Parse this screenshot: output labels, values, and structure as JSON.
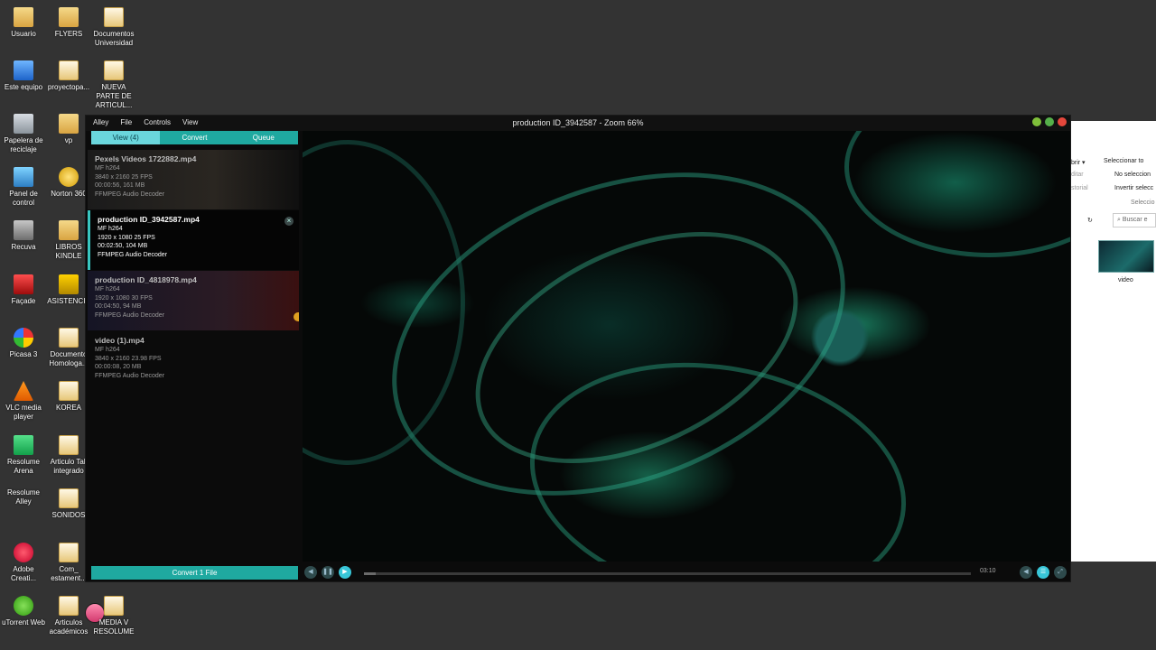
{
  "desktop": {
    "icons": [
      {
        "label": "Usuario",
        "icon": "folder-icon"
      },
      {
        "label": "FLYERS",
        "icon": "folder-icon"
      },
      {
        "label": "Documentos Universidad",
        "icon": "folder-icon"
      },
      {
        "label": "Este equipo",
        "icon": "pc-icon"
      },
      {
        "label": "proyectopa...",
        "icon": "folder-icon"
      },
      {
        "label": "NUEVA PARTE DE ARTICUL...",
        "icon": "document-icon"
      },
      {
        "label": "Papelera de reciclaje",
        "icon": "recycle-bin-icon"
      },
      {
        "label": "vp",
        "icon": "folder-icon"
      },
      {
        "label": "Panel de control",
        "icon": "control-panel-icon"
      },
      {
        "label": "Norton 360",
        "icon": "norton-icon"
      },
      {
        "label": "Recuva",
        "icon": "recuva-icon"
      },
      {
        "label": "LIBROS KINDLE",
        "icon": "folder-icon"
      },
      {
        "label": "Façade",
        "icon": "facade-icon"
      },
      {
        "label": "ASISTENCIA",
        "icon": "folder-icon"
      },
      {
        "label": "Picasa 3",
        "icon": "picasa-icon"
      },
      {
        "label": "Documento Homologa...",
        "icon": "document-icon"
      },
      {
        "label": "VLC media player",
        "icon": "vlc-icon"
      },
      {
        "label": "KOREA",
        "icon": "folder-icon"
      },
      {
        "label": "Resolume Arena",
        "icon": "resolume-icon"
      },
      {
        "label": "Articulo Tall integrado",
        "icon": "document-icon"
      },
      {
        "label": "Resolume Alley",
        "icon": "alley-icon"
      },
      {
        "label": "SONIDOS",
        "icon": "folder-icon"
      },
      {
        "label": "Adobe Creati...",
        "icon": "adobe-icon"
      },
      {
        "label": "Com_ estament...",
        "icon": "document-icon"
      },
      {
        "label": "uTorrent Web",
        "icon": "utorrent-icon"
      },
      {
        "label": "Articulos académicos",
        "icon": "folder-icon"
      },
      {
        "label": "MEDIA V RESOLUME",
        "icon": "folder-icon"
      }
    ]
  },
  "explorer": {
    "open_label": "brir ▾",
    "edit_label": "ditar",
    "history_label": "storial",
    "select_all": "Seleccionar to",
    "select_none": "No seleccion",
    "invert": "Invertir selecc",
    "section": "Seleccio",
    "search_placeholder": "Buscar e",
    "thumb_label": "video"
  },
  "app": {
    "menu": [
      "Alley",
      "File",
      "Controls",
      "View"
    ],
    "window_title": "production ID_3942587 - Zoom 66%",
    "tabs": [
      "View (4)",
      "Convert",
      "Queue"
    ],
    "files": [
      {
        "name": "Pexels Videos 1722882.mp4",
        "codec": "MF h264",
        "res": "3840 x 2160 25 FPS",
        "dur": "00:00:56, 161 MB",
        "audio": "FFMPEG Audio Decoder"
      },
      {
        "name": "production ID_3942587.mp4",
        "codec": "MF h264",
        "res": "1920 x 1080 25 FPS",
        "dur": "00:02:50, 104 MB",
        "audio": "FFMPEG Audio Decoder"
      },
      {
        "name": "production ID_4818978.mp4",
        "codec": "MF h264",
        "res": "1920 x 1080 30 FPS",
        "dur": "00:04:50, 94 MB",
        "audio": "FFMPEG Audio Decoder"
      },
      {
        "name": "video (1).mp4",
        "codec": "MF h264",
        "res": "3840 x 2160 23.98 FPS",
        "dur": "00:00:08, 20 MB",
        "audio": "FFMPEG Audio Decoder"
      }
    ],
    "selected_file_index": 1,
    "convert_button": "Convert 1 File",
    "playback": {
      "time": "03:10",
      "progress": 0.02
    },
    "accent_color": "#1fa9a0"
  }
}
